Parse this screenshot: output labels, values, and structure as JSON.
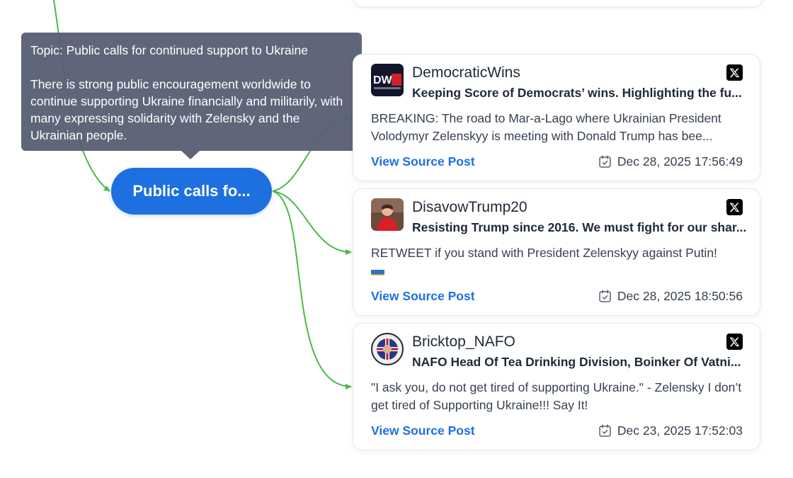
{
  "tooltip": {
    "title": "Topic: Public calls for continued support to Ukraine",
    "body": "There is strong public encouragement worldwide to continue supporting Ukraine financially and militarily, with many expressing solidarity with Zelensky and the Ukrainian people."
  },
  "topic_node": {
    "label": "Public calls fo..."
  },
  "colors": {
    "accent": "#1e6fe0",
    "connector": "#4cb84a",
    "tooltip_bg": "#565e73"
  },
  "posts": [
    {
      "author": "DemocraticWins",
      "avatar_text": "DWM",
      "bio": "Keeping Score of Democrats’ wins. Highlighting the fu...",
      "text": "BREAKING: The road to Mar-a-Lago where Ukrainian President Volodymyr Zelenskyy is meeting with Donald Trump has bee...",
      "link_label": "View Source Post",
      "date": "Dec 28, 2025 17:56:49",
      "platform_icon": "x-logo-icon"
    },
    {
      "author": "DisavowTrump20",
      "bio": "Resisting Trump since 2016. We must fight for our shar...",
      "text": "RETWEET if you stand with President Zelenskyy against Putin!",
      "emoji_icon": "ukraine-flag-icon",
      "link_label": "View Source Post",
      "date": "Dec 28, 2025 18:50:56",
      "platform_icon": "x-logo-icon"
    },
    {
      "author": "Bricktop_NAFO",
      "bio": "NAFO Head Of Tea Drinking Division, Boinker Of Vatni...",
      "text": "\"I ask you, do not get tired of supporting Ukraine.\" - Zelensky I don’t get tired of Supporting Ukraine!!! Say It!",
      "link_label": "View Source Post",
      "date": "Dec 23, 2025 17:52:03",
      "platform_icon": "x-logo-icon"
    }
  ]
}
